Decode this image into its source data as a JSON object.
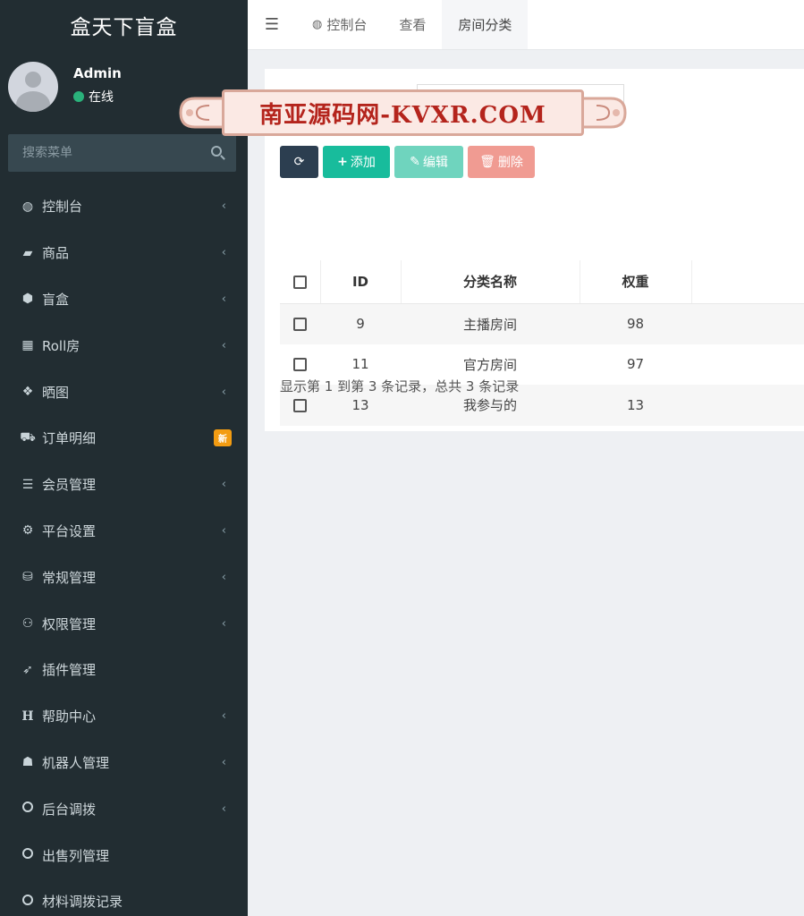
{
  "app": {
    "title": "盒天下盲盒"
  },
  "user": {
    "name": "Admin",
    "status": "在线",
    "status_color": "#2ab27b"
  },
  "search": {
    "placeholder": "搜索菜单"
  },
  "menu": [
    {
      "label": "控制台",
      "icon": "dashboard-icon",
      "glyph": "◍",
      "chevron": true
    },
    {
      "label": "商品",
      "icon": "shopping-bag-icon",
      "glyph": "▰",
      "chevron": true
    },
    {
      "label": "盲盒",
      "icon": "cube-icon",
      "glyph": "⬢",
      "chevron": true
    },
    {
      "label": "Roll房",
      "icon": "table-icon",
      "glyph": "▦",
      "chevron": true
    },
    {
      "label": "晒图",
      "icon": "dropbox-icon",
      "glyph": "❖",
      "chevron": true
    },
    {
      "label": "订单明细",
      "icon": "cart-icon",
      "glyph": "⛟",
      "badge": "新"
    },
    {
      "label": "会员管理",
      "icon": "list-icon",
      "glyph": "☰",
      "chevron": true
    },
    {
      "label": "平台设置",
      "icon": "gear-icon",
      "glyph": "⚙",
      "chevron": true
    },
    {
      "label": "常规管理",
      "icon": "database-icon",
      "glyph": "⛁",
      "chevron": true
    },
    {
      "label": "权限管理",
      "icon": "users-icon",
      "glyph": "⚇",
      "chevron": true
    },
    {
      "label": "插件管理",
      "icon": "rocket-icon",
      "glyph": "➶",
      "chevron": false
    },
    {
      "label": "帮助中心",
      "icon": "header-icon",
      "glyph": "H",
      "chevron": true
    },
    {
      "label": "机器人管理",
      "icon": "android-icon",
      "glyph": "☗",
      "chevron": true
    },
    {
      "label": "后台调拨",
      "icon": "circle-icon",
      "glyph": "",
      "chevron": true
    },
    {
      "label": "出售列管理",
      "icon": "circle-icon",
      "glyph": "",
      "chevron": false
    },
    {
      "label": "材料调拨记录",
      "icon": "circle-icon",
      "glyph": "",
      "chevron": false
    }
  ],
  "topbar": {
    "tabs": [
      {
        "label": "控制台",
        "icon": "dashboard-icon"
      },
      {
        "label": "查看"
      },
      {
        "label": "房间分类",
        "active": true
      }
    ]
  },
  "toolbar": {
    "add_label": "添加",
    "edit_label": "编辑",
    "delete_label": "删除"
  },
  "watermark": {
    "text": "南亚源码网-KVXR.COM"
  },
  "table": {
    "headers": [
      "ID",
      "分类名称",
      "权重"
    ],
    "rows": [
      {
        "id": "9",
        "name": "主播房间",
        "weight": "98"
      },
      {
        "id": "11",
        "name": "官方房间",
        "weight": "97"
      },
      {
        "id": "13",
        "name": "我参与的",
        "weight": "13"
      }
    ]
  },
  "pager": {
    "info": "显示第 1 到第 3 条记录，总共 3 条记录"
  },
  "colors": {
    "sidebar_bg": "#222d32",
    "add": "#18bc9c",
    "edit": "#6fd4be",
    "delete": "#f09b92",
    "refresh": "#2c3e50",
    "badge": "#f39c12"
  }
}
